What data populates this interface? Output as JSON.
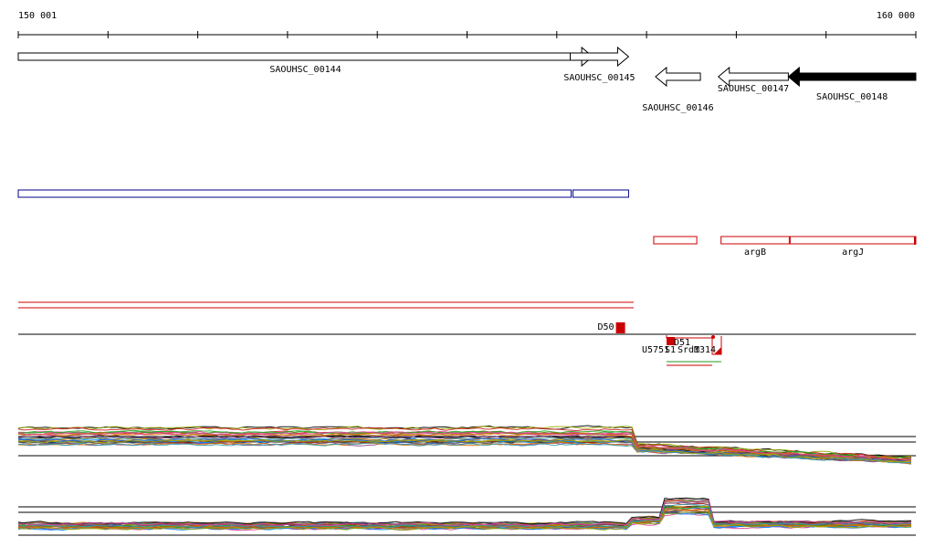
{
  "ruler": {
    "start_label": "150 001",
    "end_label": "160 000"
  },
  "genes": [
    {
      "id": "SAOUHSC_00144",
      "label": "SAOUHSC_00144",
      "start": 150001,
      "end": 156400,
      "strand": "+",
      "filled": false
    },
    {
      "id": "SAOUHSC_00145",
      "label": "SAOUHSC_00145",
      "start": 156150,
      "end": 156800,
      "strand": "+",
      "filled": false
    },
    {
      "id": "SAOUHSC_00146",
      "label": "SAOUHSC_00146",
      "start": 157100,
      "end": 157600,
      "strand": "-",
      "filled": false
    },
    {
      "id": "SAOUHSC_00147",
      "label": "SAOUHSC_00147",
      "start": 157800,
      "end": 158580,
      "strand": "-",
      "filled": false
    },
    {
      "id": "SAOUHSC_00148",
      "label": "SAOUHSC_00148",
      "start": 158580,
      "end": 160000,
      "strand": "-",
      "filled": true
    }
  ],
  "blue_features": [
    {
      "start": 150001,
      "end": 156160
    },
    {
      "start": 156180,
      "end": 156800
    }
  ],
  "red_features": [
    {
      "label": "",
      "start": 157080,
      "end": 157560
    },
    {
      "label": "argB",
      "start": 157830,
      "end": 158590
    },
    {
      "label": "argJ",
      "start": 158600,
      "end": 160000
    }
  ],
  "markers": [
    {
      "label": "D50",
      "pos": 156700
    },
    {
      "label": "D51",
      "pos": 157110
    }
  ],
  "overlap_labels": [
    "U5751",
    "S1",
    "SrdM",
    "1314"
  ],
  "colors": {
    "gene": "#000000",
    "blue": "#00008b",
    "red": "#cc0000",
    "green": "#229922"
  }
}
